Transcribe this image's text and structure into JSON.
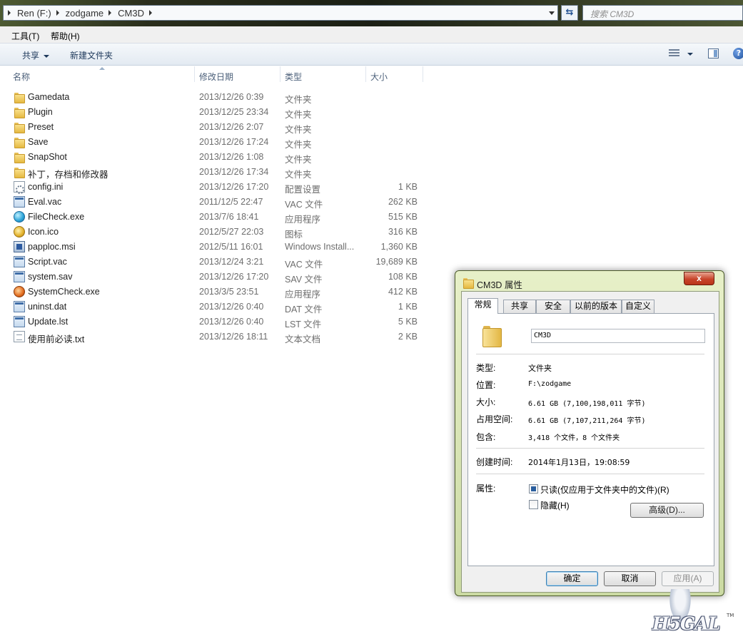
{
  "address": {
    "crumbs": [
      "Ren (F:)",
      "zodgame",
      "CM3D"
    ],
    "search_placeholder": "搜索 CM3D"
  },
  "menu": {
    "tools": "工具(T)",
    "help": "帮助(H)"
  },
  "commands": {
    "share": "共享",
    "new_folder": "新建文件夹",
    "help_icon": "?"
  },
  "columns": {
    "name": "名称",
    "date": "修改日期",
    "type": "类型",
    "size": "大小"
  },
  "files": [
    {
      "name": "Gamedata",
      "date": "2013/12/26 0:39",
      "type": "文件夹",
      "size": "",
      "icon": "folder-icon"
    },
    {
      "name": "Plugin",
      "date": "2013/12/25 23:34",
      "type": "文件夹",
      "size": "",
      "icon": "folder-icon"
    },
    {
      "name": "Preset",
      "date": "2013/12/26 2:07",
      "type": "文件夹",
      "size": "",
      "icon": "folder-icon"
    },
    {
      "name": "Save",
      "date": "2013/12/26 17:24",
      "type": "文件夹",
      "size": "",
      "icon": "folder-icon"
    },
    {
      "name": "SnapShot",
      "date": "2013/12/26 1:08",
      "type": "文件夹",
      "size": "",
      "icon": "folder-icon"
    },
    {
      "name": "补丁，存档和修改器",
      "date": "2013/12/26 17:34",
      "type": "文件夹",
      "size": "",
      "icon": "folder-icon"
    },
    {
      "name": "config.ini",
      "date": "2013/12/26 17:20",
      "type": "配置设置",
      "size": "1 KB",
      "icon": "settings-file-icon"
    },
    {
      "name": "Eval.vac",
      "date": "2011/12/5 22:47",
      "type": "VAC 文件",
      "size": "262 KB",
      "icon": "app-icon"
    },
    {
      "name": "FileCheck.exe",
      "date": "2013/7/6 18:41",
      "type": "应用程序",
      "size": "515 KB",
      "icon": "globe-icon"
    },
    {
      "name": "Icon.ico",
      "date": "2012/5/27 22:03",
      "type": "图标",
      "size": "316 KB",
      "icon": "star-icon"
    },
    {
      "name": "papploc.msi",
      "date": "2012/5/11 16:01",
      "type": "Windows Install...",
      "size": "1,360 KB",
      "icon": "installer-icon"
    },
    {
      "name": "Script.vac",
      "date": "2013/12/24 3:21",
      "type": "VAC 文件",
      "size": "19,689 KB",
      "icon": "app-icon"
    },
    {
      "name": "system.sav",
      "date": "2013/12/26 17:20",
      "type": "SAV 文件",
      "size": "108 KB",
      "icon": "app-icon"
    },
    {
      "name": "SystemCheck.exe",
      "date": "2013/3/5 23:51",
      "type": "应用程序",
      "size": "412 KB",
      "icon": "orb-icon"
    },
    {
      "name": "uninst.dat",
      "date": "2013/12/26 0:40",
      "type": "DAT 文件",
      "size": "1 KB",
      "icon": "app-icon"
    },
    {
      "name": "Update.lst",
      "date": "2013/12/26 0:40",
      "type": "LST 文件",
      "size": "5 KB",
      "icon": "app-icon"
    },
    {
      "name": "使用前必读.txt",
      "date": "2013/12/26 18:11",
      "type": "文本文档",
      "size": "2 KB",
      "icon": "text-file-icon"
    }
  ],
  "dialog": {
    "title": "CM3D 属性",
    "close": "x",
    "tabs": [
      "常规",
      "共享",
      "安全",
      "以前的版本",
      "自定义"
    ],
    "folder_name": "CM3D",
    "props": [
      {
        "label": "类型:",
        "value": "文件夹"
      },
      {
        "label": "位置:",
        "value": "F:\\zodgame"
      },
      {
        "label": "大小:",
        "value": "6.61 GB (7,100,198,011 字节)"
      },
      {
        "label": "占用空间:",
        "value": "6.61 GB (7,107,211,264 字节)"
      },
      {
        "label": "包含:",
        "value": "3,418 个文件，8 个文件夹"
      }
    ],
    "created_label": "创建时间:",
    "created_value": "2014年1月13日，19:08:59",
    "attr_label": "属性:",
    "readonly_label": "只读(仅应用于文件夹中的文件)(R)",
    "readonly_state": "indeterminate",
    "hidden_label": "隐藏(H)",
    "hidden_checked": false,
    "advanced_button": "高级(D)...",
    "ok": "确定",
    "cancel": "取消",
    "apply": "应用(A)"
  },
  "watermark": {
    "text": "H5GAL",
    "tm": "TM"
  }
}
